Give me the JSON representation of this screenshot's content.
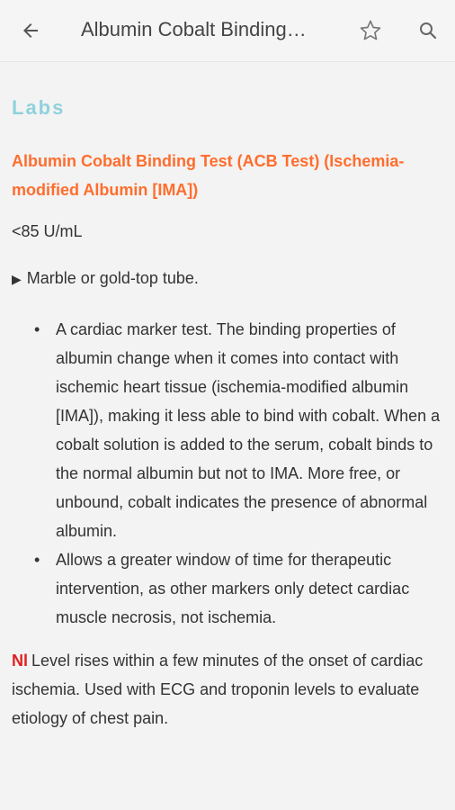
{
  "header": {
    "title": "Albumin Cobalt Binding…"
  },
  "icons": {
    "back": "back-arrow-icon",
    "favorite": "star-outline-icon",
    "search": "search-icon"
  },
  "content": {
    "section_label": "Labs",
    "test_title": "Albumin Cobalt Binding Test (ACB Test) (Ischemia-modified Albumin [IMA])",
    "normal_value": "<85 U/mL",
    "tube_text": "Marble or gold-top tube.",
    "bullets": [
      "A cardiac marker test. The binding properties of albumin change when it comes into contact with ischemic heart tissue (ischemia-modified albumin [IMA]), making it less able to bind with cobalt. When a cobalt solution is added to the serum, cobalt binds to the normal albumin but not to IMA. More free, or unbound, cobalt indicates the presence of abnormal albumin.",
      "Allows a greater window of time for therapeutic intervention, as other markers only detect cardiac muscle necrosis, not ischemia."
    ],
    "note_label": "Nl",
    "note_text": "Level rises within a few minutes of the onset of cardiac ischemia. Used with ECG and troponin levels to evaluate etiology of chest pain."
  },
  "colors": {
    "accent_orange": "#ff6d2d",
    "section_teal": "#8fd2dd",
    "note_red": "#e01f1f"
  }
}
